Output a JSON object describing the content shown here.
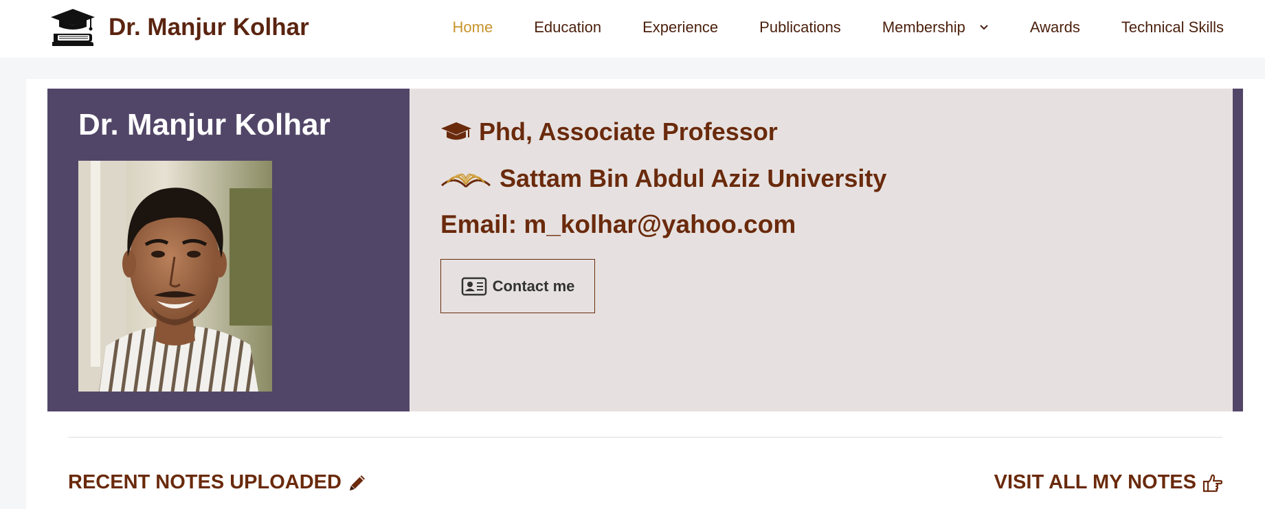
{
  "header": {
    "brand_name": "Dr. Manjur Kolhar",
    "nav": [
      {
        "label": "Home",
        "active": true
      },
      {
        "label": "Education"
      },
      {
        "label": "Experience"
      },
      {
        "label": "Publications"
      },
      {
        "label": "Membership",
        "has_dropdown": true
      },
      {
        "label": "Awards"
      },
      {
        "label": "Technical Skills"
      }
    ]
  },
  "hero": {
    "name": "Dr. Manjur Kolhar",
    "degree": "Phd, Associate Professor",
    "university": "Sattam Bin Abdul Aziz University",
    "email": "Email: m_kolhar@yahoo.com",
    "contact_button": "Contact me"
  },
  "sections": {
    "recent_notes": "RECENT NOTES UPLOADED",
    "visit_notes": "VISIT ALL MY NOTES"
  },
  "icons": {
    "logo": "graduation-cap-books-icon",
    "degree": "graduation-cap-icon",
    "university": "open-book-icon",
    "contact": "id-card-icon",
    "recent_notes": "pencil-icon",
    "visit_notes": "hand-pointer-icon",
    "dropdown": "chevron-down-icon"
  },
  "colors": {
    "accent_active": "#c8932c",
    "brand_brown": "#6a2a0c",
    "hero_purple": "#524668",
    "hero_panel": "#e6e1e0"
  }
}
